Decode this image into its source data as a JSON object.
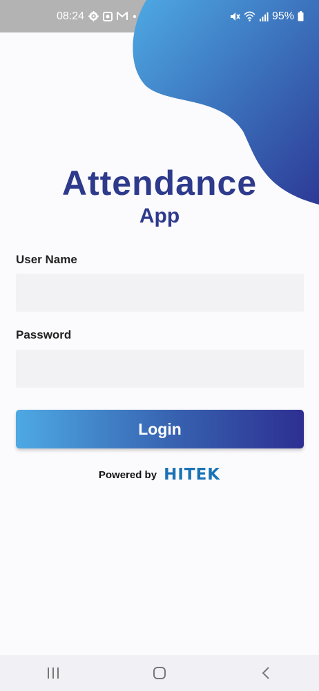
{
  "status_bar": {
    "time": "08:24",
    "battery": "95%",
    "icons_left": [
      "gear-icon",
      "photo-icon",
      "mail-icon",
      "dot-icon"
    ],
    "icons_right": [
      "mute-icon",
      "wifi-icon",
      "signal-icon",
      "battery-icon"
    ]
  },
  "app": {
    "title": "Attendance",
    "subtitle": "App"
  },
  "form": {
    "username_label": "User Name",
    "username_value": "",
    "password_label": "Password",
    "password_value": "",
    "login_label": "Login"
  },
  "footer": {
    "powered_by": "Powered by",
    "brand": "HITEK"
  },
  "colors": {
    "primary_dark": "#2e3a8c",
    "primary_light": "#4ea9e3",
    "input_bg": "#f2f2f4"
  },
  "nav_bar": {
    "icons": [
      "recent-apps-icon",
      "home-icon",
      "back-icon"
    ]
  }
}
